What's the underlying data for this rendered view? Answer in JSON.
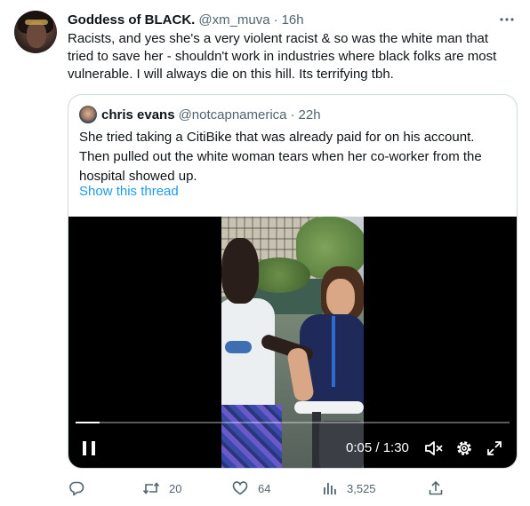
{
  "tweet": {
    "author_name": "Goddess of BLACK.",
    "author_handle": "@xm_muva",
    "separator": "·",
    "time": "16h",
    "text_lines": [
      "Racists, and yes she's a very violent racist & so was the white man that",
      "tried to save her - shouldn't work in industries where black folks are most",
      "vulnerable. I will always die on this hill. Its terrifying tbh."
    ]
  },
  "quote": {
    "author_name": "chris evans",
    "author_handle": "@notcapnamerica",
    "separator": "·",
    "time": "22h",
    "text_lines": [
      "She tried taking a CitiBike that was already paid for on his account.",
      "Then pulled out the white woman tears when her co-worker from the",
      "hospital showed up."
    ],
    "show_thread": "Show this thread"
  },
  "video": {
    "time_display": "0:05 / 1:30",
    "progress": 0.055,
    "controls": [
      "pause-icon",
      "mute-icon",
      "settings-icon",
      "fullscreen-icon"
    ]
  },
  "actions": {
    "replies": "",
    "retweets": "20",
    "likes": "64",
    "views": "3,525"
  },
  "colors": {
    "accent": "#1d9bf0",
    "secondary_text": "#536471",
    "border": "#cfd9de"
  }
}
